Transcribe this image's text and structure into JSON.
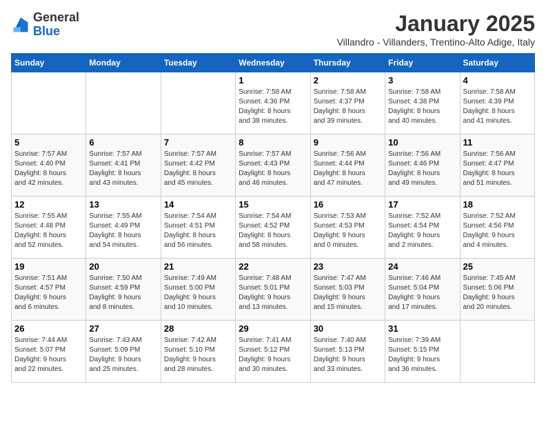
{
  "logo": {
    "general": "General",
    "blue": "Blue"
  },
  "header": {
    "month_year": "January 2025",
    "subtitle": "Villandro - Villanders, Trentino-Alto Adige, Italy"
  },
  "days_of_week": [
    "Sunday",
    "Monday",
    "Tuesday",
    "Wednesday",
    "Thursday",
    "Friday",
    "Saturday"
  ],
  "weeks": [
    [
      {
        "day": "",
        "details": ""
      },
      {
        "day": "",
        "details": ""
      },
      {
        "day": "",
        "details": ""
      },
      {
        "day": "1",
        "details": "Sunrise: 7:58 AM\nSunset: 4:36 PM\nDaylight: 8 hours\nand 38 minutes."
      },
      {
        "day": "2",
        "details": "Sunrise: 7:58 AM\nSunset: 4:37 PM\nDaylight: 8 hours\nand 39 minutes."
      },
      {
        "day": "3",
        "details": "Sunrise: 7:58 AM\nSunset: 4:38 PM\nDaylight: 8 hours\nand 40 minutes."
      },
      {
        "day": "4",
        "details": "Sunrise: 7:58 AM\nSunset: 4:39 PM\nDaylight: 8 hours\nand 41 minutes."
      }
    ],
    [
      {
        "day": "5",
        "details": "Sunrise: 7:57 AM\nSunset: 4:40 PM\nDaylight: 8 hours\nand 42 minutes."
      },
      {
        "day": "6",
        "details": "Sunrise: 7:57 AM\nSunset: 4:41 PM\nDaylight: 8 hours\nand 43 minutes."
      },
      {
        "day": "7",
        "details": "Sunrise: 7:57 AM\nSunset: 4:42 PM\nDaylight: 8 hours\nand 45 minutes."
      },
      {
        "day": "8",
        "details": "Sunrise: 7:57 AM\nSunset: 4:43 PM\nDaylight: 8 hours\nand 46 minutes."
      },
      {
        "day": "9",
        "details": "Sunrise: 7:56 AM\nSunset: 4:44 PM\nDaylight: 8 hours\nand 47 minutes."
      },
      {
        "day": "10",
        "details": "Sunrise: 7:56 AM\nSunset: 4:46 PM\nDaylight: 8 hours\nand 49 minutes."
      },
      {
        "day": "11",
        "details": "Sunrise: 7:56 AM\nSunset: 4:47 PM\nDaylight: 8 hours\nand 51 minutes."
      }
    ],
    [
      {
        "day": "12",
        "details": "Sunrise: 7:55 AM\nSunset: 4:48 PM\nDaylight: 8 hours\nand 52 minutes."
      },
      {
        "day": "13",
        "details": "Sunrise: 7:55 AM\nSunset: 4:49 PM\nDaylight: 8 hours\nand 54 minutes."
      },
      {
        "day": "14",
        "details": "Sunrise: 7:54 AM\nSunset: 4:51 PM\nDaylight: 8 hours\nand 56 minutes."
      },
      {
        "day": "15",
        "details": "Sunrise: 7:54 AM\nSunset: 4:52 PM\nDaylight: 8 hours\nand 58 minutes."
      },
      {
        "day": "16",
        "details": "Sunrise: 7:53 AM\nSunset: 4:53 PM\nDaylight: 9 hours\nand 0 minutes."
      },
      {
        "day": "17",
        "details": "Sunrise: 7:52 AM\nSunset: 4:54 PM\nDaylight: 9 hours\nand 2 minutes."
      },
      {
        "day": "18",
        "details": "Sunrise: 7:52 AM\nSunset: 4:56 PM\nDaylight: 9 hours\nand 4 minutes."
      }
    ],
    [
      {
        "day": "19",
        "details": "Sunrise: 7:51 AM\nSunset: 4:57 PM\nDaylight: 9 hours\nand 6 minutes."
      },
      {
        "day": "20",
        "details": "Sunrise: 7:50 AM\nSunset: 4:59 PM\nDaylight: 9 hours\nand 8 minutes."
      },
      {
        "day": "21",
        "details": "Sunrise: 7:49 AM\nSunset: 5:00 PM\nDaylight: 9 hours\nand 10 minutes."
      },
      {
        "day": "22",
        "details": "Sunrise: 7:48 AM\nSunset: 5:01 PM\nDaylight: 9 hours\nand 13 minutes."
      },
      {
        "day": "23",
        "details": "Sunrise: 7:47 AM\nSunset: 5:03 PM\nDaylight: 9 hours\nand 15 minutes."
      },
      {
        "day": "24",
        "details": "Sunrise: 7:46 AM\nSunset: 5:04 PM\nDaylight: 9 hours\nand 17 minutes."
      },
      {
        "day": "25",
        "details": "Sunrise: 7:45 AM\nSunset: 5:06 PM\nDaylight: 9 hours\nand 20 minutes."
      }
    ],
    [
      {
        "day": "26",
        "details": "Sunrise: 7:44 AM\nSunset: 5:07 PM\nDaylight: 9 hours\nand 22 minutes."
      },
      {
        "day": "27",
        "details": "Sunrise: 7:43 AM\nSunset: 5:09 PM\nDaylight: 9 hours\nand 25 minutes."
      },
      {
        "day": "28",
        "details": "Sunrise: 7:42 AM\nSunset: 5:10 PM\nDaylight: 9 hours\nand 28 minutes."
      },
      {
        "day": "29",
        "details": "Sunrise: 7:41 AM\nSunset: 5:12 PM\nDaylight: 9 hours\nand 30 minutes."
      },
      {
        "day": "30",
        "details": "Sunrise: 7:40 AM\nSunset: 5:13 PM\nDaylight: 9 hours\nand 33 minutes."
      },
      {
        "day": "31",
        "details": "Sunrise: 7:39 AM\nSunset: 5:15 PM\nDaylight: 9 hours\nand 36 minutes."
      },
      {
        "day": "",
        "details": ""
      }
    ]
  ]
}
